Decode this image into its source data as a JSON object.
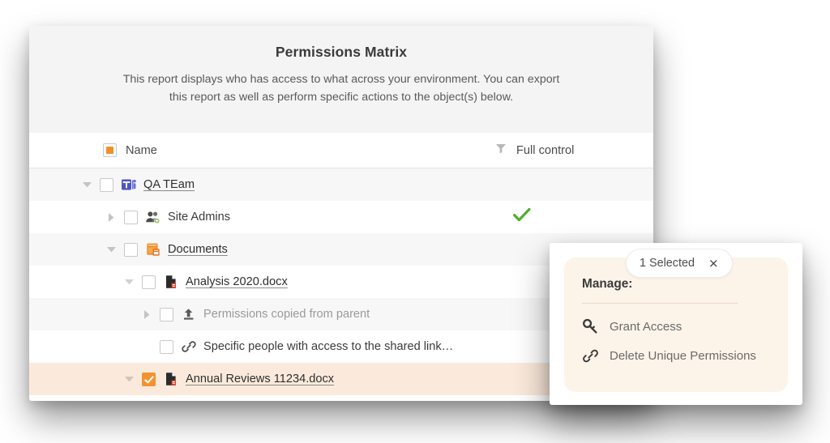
{
  "report": {
    "title": "Permissions Matrix",
    "description": "This report displays who has access to what across your environment. You can export this report as well as perform specific actions to the object(s) below.",
    "columns": {
      "name": "Name",
      "full_control": "Full control"
    },
    "rows": [
      {
        "label": "QA TEam",
        "icon": "teams-icon",
        "indent": "i0",
        "twisty": "down",
        "checkbox": "unchecked",
        "style": "link",
        "full_control": "",
        "shade": "alt"
      },
      {
        "label": "Site Admins",
        "icon": "user-group-icon",
        "indent": "i1",
        "twisty": "right",
        "checkbox": "unchecked",
        "style": "plain",
        "full_control": "check",
        "shade": "white"
      },
      {
        "label": "Documents",
        "icon": "document-library-icon",
        "indent": "i2",
        "twisty": "down",
        "checkbox": "unchecked",
        "style": "link",
        "full_control": "",
        "shade": "alt"
      },
      {
        "label": "Analysis 2020.docx",
        "icon": "word-document-icon",
        "indent": "i3",
        "twisty": "down",
        "checkbox": "unchecked",
        "style": "link",
        "full_control": "",
        "shade": "white"
      },
      {
        "label": "Permissions copied from parent",
        "icon": "inherit-arrow-icon",
        "indent": "i4",
        "twisty": "right",
        "checkbox": "unchecked",
        "style": "muted",
        "full_control": "",
        "shade": "alt"
      },
      {
        "label": "Specific people with access to the shared link…",
        "icon": "link-icon",
        "indent": "i5",
        "twisty": "none",
        "checkbox": "unchecked",
        "style": "plain",
        "full_control": "",
        "shade": "white"
      },
      {
        "label": "Annual Reviews 11234.docx",
        "icon": "word-document-icon",
        "indent": "i6",
        "twisty": "down",
        "checkbox": "checked",
        "style": "link",
        "full_control": "",
        "shade": "sel"
      }
    ]
  },
  "popup": {
    "selected_badge": "1 Selected",
    "close": "×",
    "heading": "Manage:",
    "actions": [
      {
        "label": "Grant Access",
        "icon": "key-icon"
      },
      {
        "label": "Delete Unique Permissions",
        "icon": "broken-link-icon"
      }
    ]
  },
  "colors": {
    "accent_orange": "#F29230",
    "check_green": "#4FAE2F",
    "teams_purple": "#5059C9",
    "selected_row": "#FBEADB",
    "panel_cream": "#FCF3E9"
  }
}
